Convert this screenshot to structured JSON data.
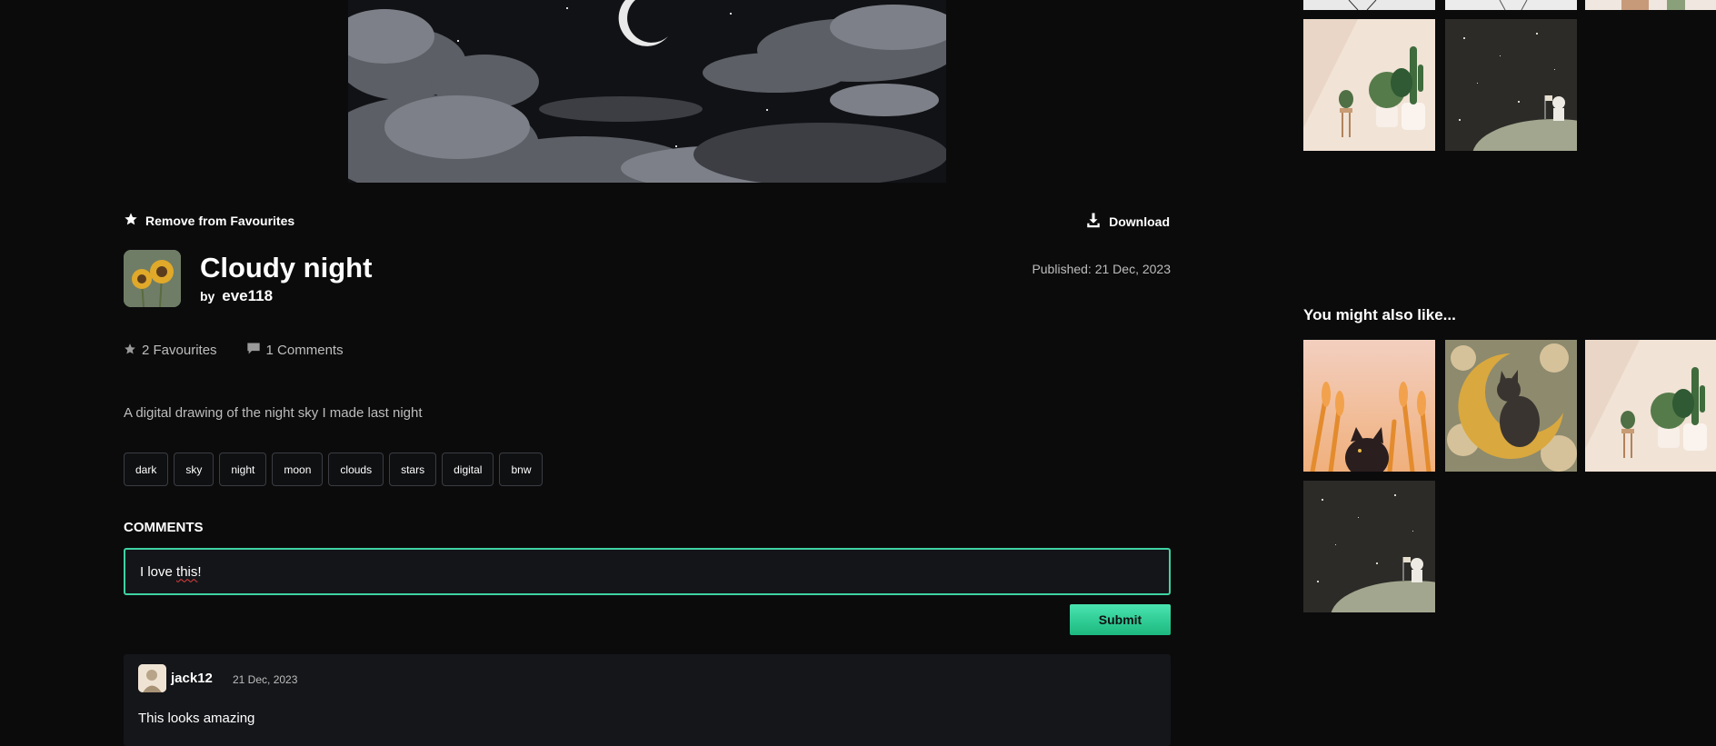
{
  "artwork": {
    "alt": "Cloudy night pixel art"
  },
  "actions": {
    "favourite_label": "Remove from Favourites",
    "download_label": "Download"
  },
  "post": {
    "title": "Cloudy night",
    "by_label": "by",
    "author": "eve118",
    "published": "Published: 21 Dec, 2023",
    "favourites": "2 Favourites",
    "comments_count": "1 Comments",
    "description": "A digital drawing of the night sky I made last night",
    "tags": [
      "dark",
      "sky",
      "night",
      "moon",
      "clouds",
      "stars",
      "digital",
      "bnw"
    ]
  },
  "comments": {
    "heading": "COMMENTS",
    "input_value_a": "I love ",
    "input_value_b": "this",
    "input_value_c": "!",
    "submit_label": "Submit",
    "items": [
      {
        "user": "jack12",
        "date": "21 Dec, 2023",
        "text": "This looks amazing"
      }
    ]
  },
  "sidebar": {
    "heading": "You might also like...",
    "thumbnails": [
      "sketch-portrait",
      "sketch-portrait",
      "colorful-art",
      "plants",
      "astronaut-moon",
      "wheat-cat",
      "moon-cat",
      "plants",
      "astronaut-moon"
    ]
  },
  "icons": {
    "star": "star-icon",
    "download": "download-icon",
    "comment": "comment-icon"
  },
  "colors": {
    "accent": "#3fd3a2",
    "background": "#0b0b0c",
    "panel": "#15161a",
    "muted_text": "#bdbdbd"
  }
}
